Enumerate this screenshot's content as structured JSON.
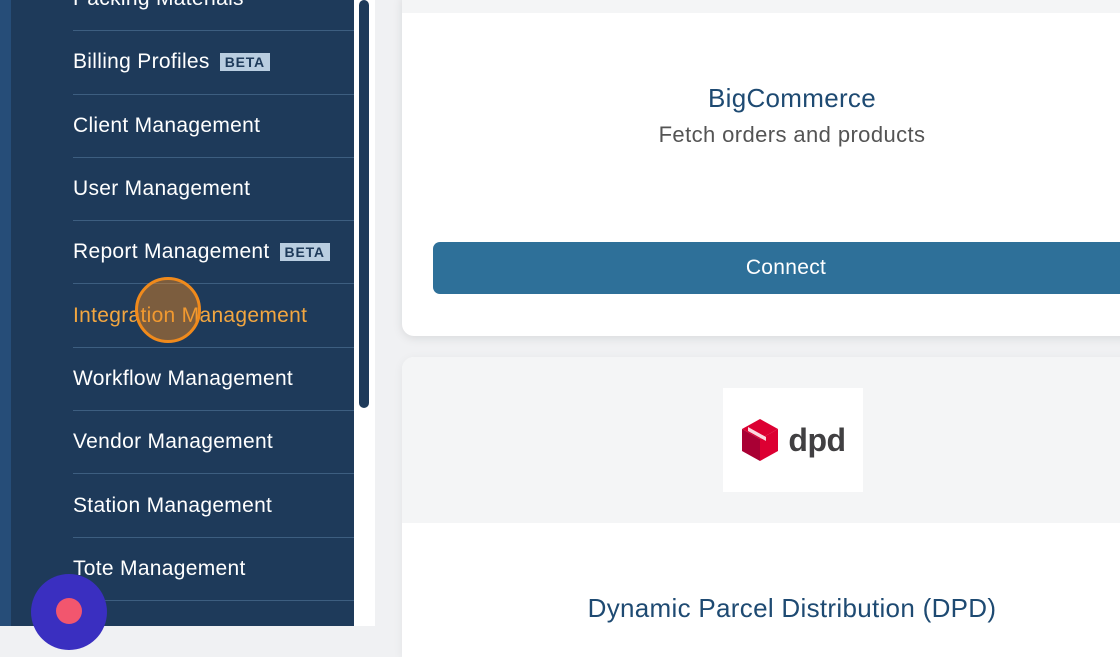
{
  "sidebar": {
    "items": [
      {
        "label": "Packing Materials",
        "badge": ""
      },
      {
        "label": "Billing Profiles",
        "badge": "BETA"
      },
      {
        "label": "Client Management",
        "badge": ""
      },
      {
        "label": "User Management",
        "badge": ""
      },
      {
        "label": "Report Management",
        "badge": "BETA"
      },
      {
        "label": "Integration Management",
        "badge": "",
        "active": true
      },
      {
        "label": "Workflow Management",
        "badge": ""
      },
      {
        "label": "Vendor Management",
        "badge": ""
      },
      {
        "label": "Station Management",
        "badge": ""
      },
      {
        "label": "Tote Management",
        "badge": ""
      }
    ],
    "active_color": "#f2a640"
  },
  "integrations": [
    {
      "title": "BigCommerce",
      "description": "Fetch orders and products",
      "button_label": "Connect"
    },
    {
      "title": "Dynamic Parcel Distribution (DPD)",
      "logo_text": "dpd",
      "logo_icon": "dpd-cube-logo"
    }
  ],
  "colors": {
    "sidebar_bg": "#1e3a5a",
    "button_bg": "#2e7099",
    "title_color": "#1e4a72",
    "dpd_red": "#dc0032"
  }
}
